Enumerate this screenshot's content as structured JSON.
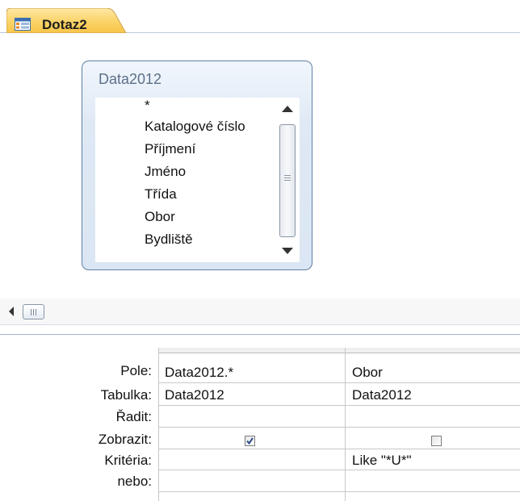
{
  "tab": {
    "label": "Dotaz2",
    "icon": "query-table-icon"
  },
  "table_box": {
    "title": "Data2012",
    "fields": [
      "*",
      "Katalogové číslo",
      "Příjmení",
      "Jméno",
      "Třída",
      "Obor",
      "Bydliště"
    ]
  },
  "grid": {
    "row_labels": [
      "Pole:",
      "Tabulka:",
      "Řadit:",
      "Zobrazit:",
      "Kritéria:",
      "nebo:"
    ],
    "columns": [
      {
        "pole": "Data2012.*",
        "tabulka": "Data2012",
        "radit": "",
        "zobrazit": true,
        "kriteria": "",
        "nebo": ""
      },
      {
        "pole": "Obor",
        "tabulka": "Data2012",
        "radit": "",
        "zobrazit": false,
        "kriteria": "Like \"*U*\"",
        "nebo": ""
      }
    ]
  },
  "colors": {
    "tab_fill": "#fbd56c",
    "table_border": "#5f7fa8",
    "table_title": "#5c7089",
    "checkmark": "#2b4a8a"
  }
}
